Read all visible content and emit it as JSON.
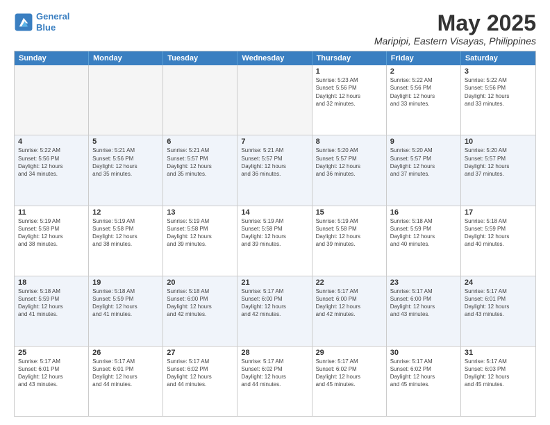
{
  "header": {
    "logo_line1": "General",
    "logo_line2": "Blue",
    "title": "May 2025",
    "subtitle": "Maripipi, Eastern Visayas, Philippines"
  },
  "days_of_week": [
    "Sunday",
    "Monday",
    "Tuesday",
    "Wednesday",
    "Thursday",
    "Friday",
    "Saturday"
  ],
  "rows": [
    {
      "alt": false,
      "cells": [
        {
          "day": "",
          "empty": true,
          "info": ""
        },
        {
          "day": "",
          "empty": true,
          "info": ""
        },
        {
          "day": "",
          "empty": true,
          "info": ""
        },
        {
          "day": "",
          "empty": true,
          "info": ""
        },
        {
          "day": "1",
          "empty": false,
          "info": "Sunrise: 5:23 AM\nSunset: 5:56 PM\nDaylight: 12 hours\nand 32 minutes."
        },
        {
          "day": "2",
          "empty": false,
          "info": "Sunrise: 5:22 AM\nSunset: 5:56 PM\nDaylight: 12 hours\nand 33 minutes."
        },
        {
          "day": "3",
          "empty": false,
          "info": "Sunrise: 5:22 AM\nSunset: 5:56 PM\nDaylight: 12 hours\nand 33 minutes."
        }
      ]
    },
    {
      "alt": true,
      "cells": [
        {
          "day": "4",
          "empty": false,
          "info": "Sunrise: 5:22 AM\nSunset: 5:56 PM\nDaylight: 12 hours\nand 34 minutes."
        },
        {
          "day": "5",
          "empty": false,
          "info": "Sunrise: 5:21 AM\nSunset: 5:56 PM\nDaylight: 12 hours\nand 35 minutes."
        },
        {
          "day": "6",
          "empty": false,
          "info": "Sunrise: 5:21 AM\nSunset: 5:57 PM\nDaylight: 12 hours\nand 35 minutes."
        },
        {
          "day": "7",
          "empty": false,
          "info": "Sunrise: 5:21 AM\nSunset: 5:57 PM\nDaylight: 12 hours\nand 36 minutes."
        },
        {
          "day": "8",
          "empty": false,
          "info": "Sunrise: 5:20 AM\nSunset: 5:57 PM\nDaylight: 12 hours\nand 36 minutes."
        },
        {
          "day": "9",
          "empty": false,
          "info": "Sunrise: 5:20 AM\nSunset: 5:57 PM\nDaylight: 12 hours\nand 37 minutes."
        },
        {
          "day": "10",
          "empty": false,
          "info": "Sunrise: 5:20 AM\nSunset: 5:57 PM\nDaylight: 12 hours\nand 37 minutes."
        }
      ]
    },
    {
      "alt": false,
      "cells": [
        {
          "day": "11",
          "empty": false,
          "info": "Sunrise: 5:19 AM\nSunset: 5:58 PM\nDaylight: 12 hours\nand 38 minutes."
        },
        {
          "day": "12",
          "empty": false,
          "info": "Sunrise: 5:19 AM\nSunset: 5:58 PM\nDaylight: 12 hours\nand 38 minutes."
        },
        {
          "day": "13",
          "empty": false,
          "info": "Sunrise: 5:19 AM\nSunset: 5:58 PM\nDaylight: 12 hours\nand 39 minutes."
        },
        {
          "day": "14",
          "empty": false,
          "info": "Sunrise: 5:19 AM\nSunset: 5:58 PM\nDaylight: 12 hours\nand 39 minutes."
        },
        {
          "day": "15",
          "empty": false,
          "info": "Sunrise: 5:19 AM\nSunset: 5:58 PM\nDaylight: 12 hours\nand 39 minutes."
        },
        {
          "day": "16",
          "empty": false,
          "info": "Sunrise: 5:18 AM\nSunset: 5:59 PM\nDaylight: 12 hours\nand 40 minutes."
        },
        {
          "day": "17",
          "empty": false,
          "info": "Sunrise: 5:18 AM\nSunset: 5:59 PM\nDaylight: 12 hours\nand 40 minutes."
        }
      ]
    },
    {
      "alt": true,
      "cells": [
        {
          "day": "18",
          "empty": false,
          "info": "Sunrise: 5:18 AM\nSunset: 5:59 PM\nDaylight: 12 hours\nand 41 minutes."
        },
        {
          "day": "19",
          "empty": false,
          "info": "Sunrise: 5:18 AM\nSunset: 5:59 PM\nDaylight: 12 hours\nand 41 minutes."
        },
        {
          "day": "20",
          "empty": false,
          "info": "Sunrise: 5:18 AM\nSunset: 6:00 PM\nDaylight: 12 hours\nand 42 minutes."
        },
        {
          "day": "21",
          "empty": false,
          "info": "Sunrise: 5:17 AM\nSunset: 6:00 PM\nDaylight: 12 hours\nand 42 minutes."
        },
        {
          "day": "22",
          "empty": false,
          "info": "Sunrise: 5:17 AM\nSunset: 6:00 PM\nDaylight: 12 hours\nand 42 minutes."
        },
        {
          "day": "23",
          "empty": false,
          "info": "Sunrise: 5:17 AM\nSunset: 6:00 PM\nDaylight: 12 hours\nand 43 minutes."
        },
        {
          "day": "24",
          "empty": false,
          "info": "Sunrise: 5:17 AM\nSunset: 6:01 PM\nDaylight: 12 hours\nand 43 minutes."
        }
      ]
    },
    {
      "alt": false,
      "cells": [
        {
          "day": "25",
          "empty": false,
          "info": "Sunrise: 5:17 AM\nSunset: 6:01 PM\nDaylight: 12 hours\nand 43 minutes."
        },
        {
          "day": "26",
          "empty": false,
          "info": "Sunrise: 5:17 AM\nSunset: 6:01 PM\nDaylight: 12 hours\nand 44 minutes."
        },
        {
          "day": "27",
          "empty": false,
          "info": "Sunrise: 5:17 AM\nSunset: 6:02 PM\nDaylight: 12 hours\nand 44 minutes."
        },
        {
          "day": "28",
          "empty": false,
          "info": "Sunrise: 5:17 AM\nSunset: 6:02 PM\nDaylight: 12 hours\nand 44 minutes."
        },
        {
          "day": "29",
          "empty": false,
          "info": "Sunrise: 5:17 AM\nSunset: 6:02 PM\nDaylight: 12 hours\nand 45 minutes."
        },
        {
          "day": "30",
          "empty": false,
          "info": "Sunrise: 5:17 AM\nSunset: 6:02 PM\nDaylight: 12 hours\nand 45 minutes."
        },
        {
          "day": "31",
          "empty": false,
          "info": "Sunrise: 5:17 AM\nSunset: 6:03 PM\nDaylight: 12 hours\nand 45 minutes."
        }
      ]
    }
  ]
}
